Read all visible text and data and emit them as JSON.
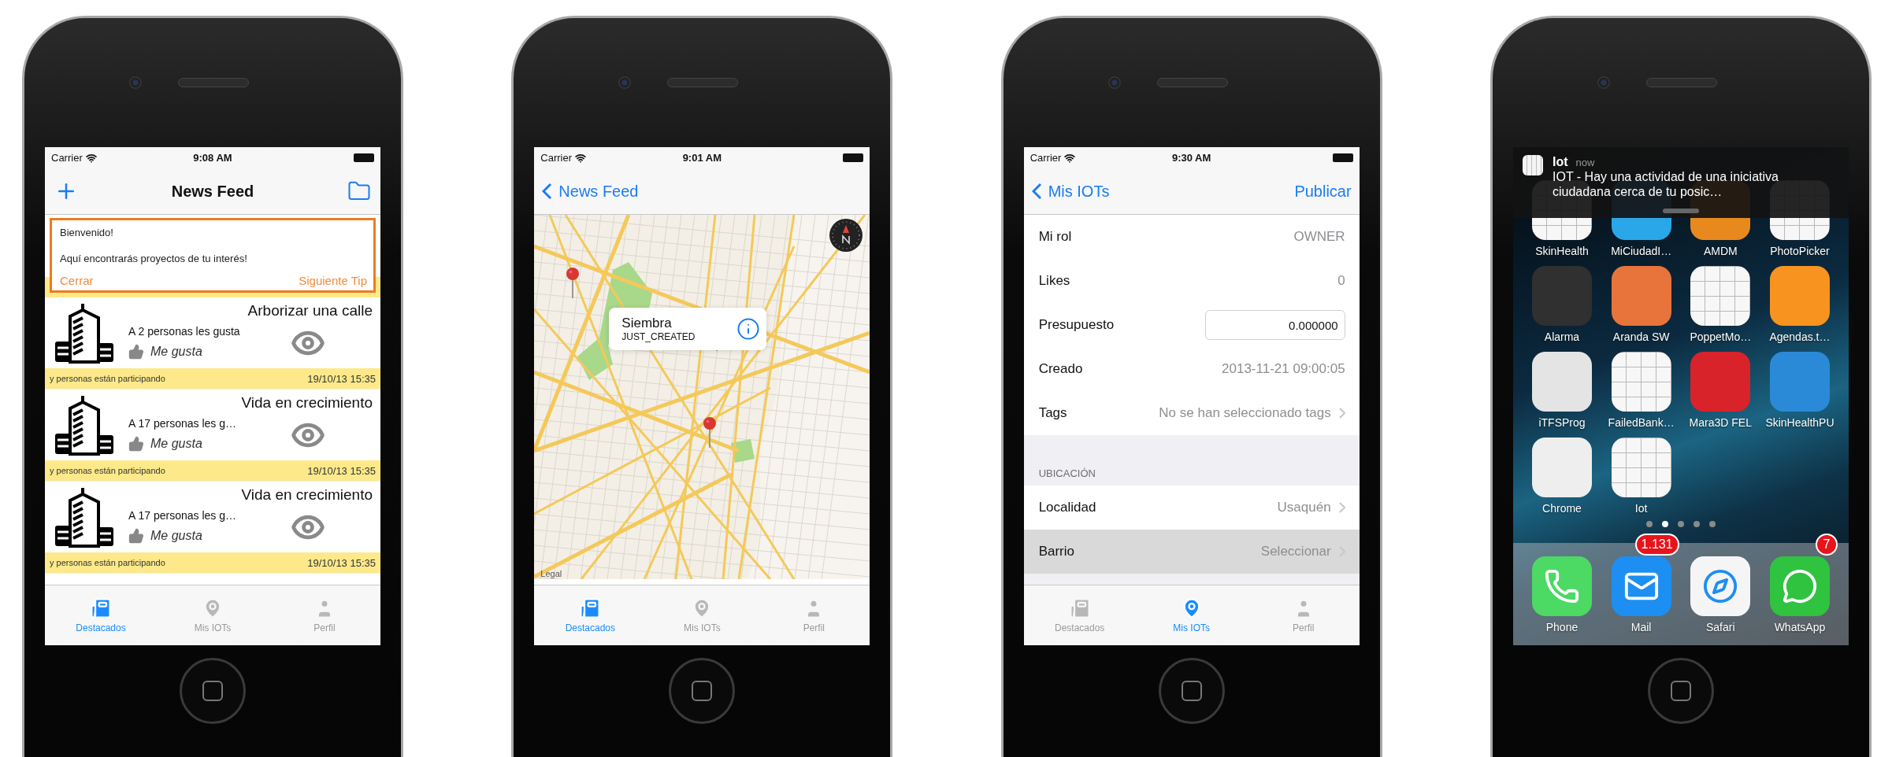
{
  "phones": [
    {
      "kind": "news_feed",
      "status_bar": {
        "carrier": "Carrier",
        "time": "9:08 AM"
      },
      "nav": {
        "title": "News Feed"
      },
      "tip": {
        "title": "Bienvenido!",
        "message": "Aquí encontrarás proyectos de tu interés!",
        "buttons": [
          "Cerrar",
          "Siguiente Tip"
        ]
      },
      "cards": [
        {
          "title": "Arborizar una calle",
          "likes": "A 2 personas les gusta",
          "like_label": "Me gusta",
          "participants": "y personas están participando",
          "date": "19/10/13 15:35"
        },
        {
          "title": "Vida en crecimiento",
          "likes": "A 17 personas les g…",
          "like_label": "Me gusta",
          "participants": "y personas están participando",
          "date": "19/10/13 15:35"
        },
        {
          "title": "Vida en crecimiento",
          "likes": "A 17 personas les g…",
          "like_label": "Me gusta",
          "participants": "y personas están participando",
          "date": "19/10/13 15:35"
        }
      ],
      "tabs": [
        {
          "kind": "news",
          "label": "Destacados",
          "selected": true
        },
        {
          "kind": "pin",
          "label": "Mis IOTs",
          "selected": false
        },
        {
          "kind": "person",
          "label": "Perfil",
          "selected": false
        }
      ]
    },
    {
      "kind": "map",
      "status_bar": {
        "carrier": "Carrier",
        "time": "9:01 AM"
      },
      "nav": {
        "back": "News Feed"
      },
      "callout": {
        "title": "Siembra",
        "subtitle": "JUST_CREATED"
      },
      "legal": "Legal",
      "tabs": [
        {
          "kind": "news",
          "label": "Destacados",
          "selected": true
        },
        {
          "kind": "pin",
          "label": "Mis IOTs",
          "selected": false
        },
        {
          "kind": "person",
          "label": "Perfil",
          "selected": false
        }
      ]
    },
    {
      "kind": "form",
      "status_bar": {
        "carrier": "Carrier",
        "time": "9:30 AM"
      },
      "nav": {
        "back": "Mis IOTs",
        "action": "Publicar"
      },
      "sections": [
        {
          "rows": [
            {
              "kind": "value",
              "label": "Mi rol",
              "value": "OWNER",
              "selected": false
            },
            {
              "kind": "value",
              "label": "Likes",
              "value": "0",
              "selected": false
            },
            {
              "kind": "field",
              "label": "Presupuesto",
              "value": "0.000000",
              "selected": false
            },
            {
              "kind": "value",
              "label": "Creado",
              "value": "2013-11-21 09:00:05",
              "selected": false
            },
            {
              "kind": "disclosure",
              "label": "Tags",
              "value": "No se han seleccionado tags",
              "selected": false
            }
          ]
        },
        {
          "header": "UBICACIÓN",
          "rows": [
            {
              "kind": "disclosure",
              "label": "Localidad",
              "value": "Usaquén",
              "selected": false
            },
            {
              "kind": "disclosure",
              "label": "Barrio",
              "value": "Seleccionar",
              "selected": true
            }
          ]
        }
      ],
      "tabs": [
        {
          "kind": "news",
          "label": "Destacados",
          "selected": false
        },
        {
          "kind": "pin",
          "label": "Mis IOTs",
          "selected": true
        },
        {
          "kind": "person",
          "label": "Perfil",
          "selected": false
        }
      ]
    },
    {
      "kind": "home",
      "notification": {
        "app": "Iot",
        "time": "now",
        "message": "IOT - Hay una actividad de una iniciativa ciudadana cerca de tu posic…"
      },
      "apps": [
        {
          "kind": "blank",
          "label": "SkinHealth"
        },
        {
          "kind": "logo",
          "label": "MiCiudadI…",
          "color": "#2aa7e8"
        },
        {
          "kind": "logo",
          "label": "AMDM",
          "color": "#e8891e"
        },
        {
          "kind": "blank",
          "label": "PhotoPicker"
        },
        {
          "kind": "logo",
          "label": "Alarma",
          "color": "#303030"
        },
        {
          "kind": "logo",
          "label": "Aranda SW",
          "color": "#e8743b"
        },
        {
          "kind": "blank",
          "label": "PoppetMo…"
        },
        {
          "kind": "logo",
          "label": "Agendas.t…",
          "color": "#f7931e"
        },
        {
          "kind": "logo",
          "label": "iTFSProg",
          "color": "#e4e4e4"
        },
        {
          "kind": "blank",
          "label": "FailedBank…"
        },
        {
          "kind": "logo",
          "label": "Mara3D FEL",
          "color": "#d8232a"
        },
        {
          "kind": "logo",
          "label": "SkinHealthPU",
          "color": "#2a8ad8"
        },
        {
          "kind": "logo",
          "label": "Chrome",
          "color": "#eeeeee"
        },
        {
          "kind": "blank",
          "label": "Iot"
        }
      ],
      "page_dots": [
        {
          "selected": false
        },
        {
          "selected": true
        },
        {
          "selected": false
        },
        {
          "selected": false
        },
        {
          "selected": false
        }
      ],
      "dock": [
        {
          "kind": "phone",
          "label": "Phone",
          "color": "#4cd964"
        },
        {
          "kind": "mail",
          "label": "Mail",
          "color": "#1d8ff2",
          "badge": "1.131"
        },
        {
          "kind": "safari",
          "label": "Safari",
          "color": "#f5f5f5"
        },
        {
          "kind": "chat",
          "label": "WhatsApp",
          "color": "#2fc340",
          "badge": "7"
        }
      ]
    }
  ]
}
